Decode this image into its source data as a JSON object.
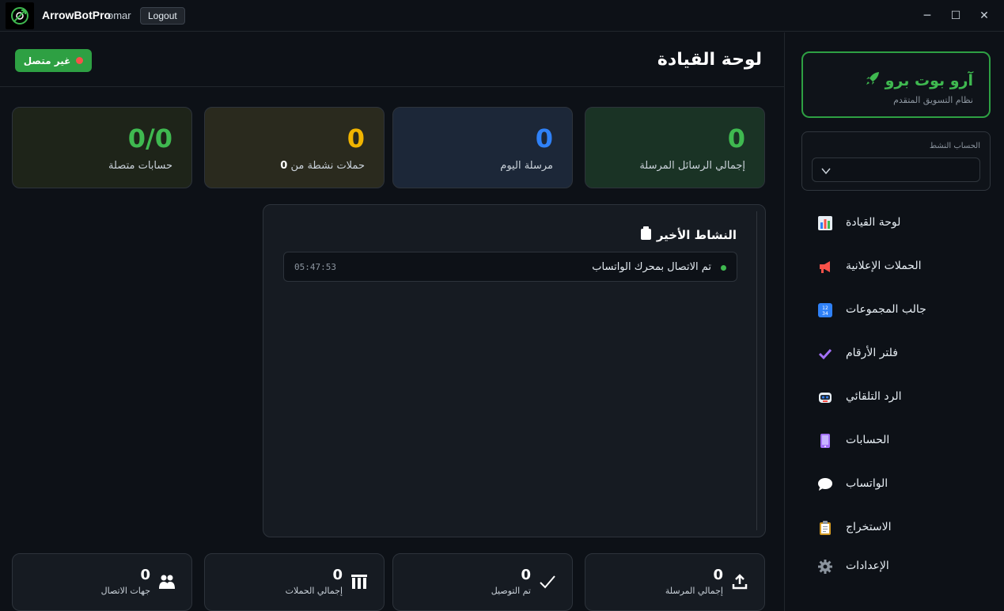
{
  "titlebar": {
    "app_name": "ArrowBotPro",
    "user": "omar",
    "logout_label": "Logout",
    "minimize": "─",
    "maximize": "☐",
    "close": "✕"
  },
  "header": {
    "title": "لوحة القيادة",
    "status_label": "غير متصل",
    "status_color": "#f85149"
  },
  "stats": [
    {
      "value": "0",
      "label": "إجمالي الرسائل المرسلة",
      "color": "#3fb950"
    },
    {
      "value": "0",
      "label": "مرسلة اليوم",
      "color": "#2f81f7"
    },
    {
      "value": "0",
      "label_prefix": "حملات نشطة من",
      "label_num": "0",
      "color": "#f0b400"
    },
    {
      "value": "0/0",
      "label": "حسابات متصلة",
      "color": "#3fb950"
    }
  ],
  "activity": {
    "title": "النشاط الأخير",
    "icon": "clipboard-icon",
    "items": [
      {
        "text": "تم الاتصال بمحرك الواتساب",
        "time": "05:47:53"
      }
    ]
  },
  "bottom_stats": [
    {
      "value": "0",
      "label": "إجمالي المرسلة",
      "icon": "upload-icon"
    },
    {
      "value": "0",
      "label": "تم التوصيل",
      "icon": "check-icon"
    },
    {
      "value": "0",
      "label": "إجمالي الحملات",
      "icon": "bars-icon"
    },
    {
      "value": "0",
      "label": "جهات الاتصال",
      "icon": "users-icon"
    }
  ],
  "sidebar": {
    "brand_title": "آرو بوت برو",
    "brand_subtitle": "نظام التسويق المتقدم",
    "account_label": "الحساب النشط",
    "nav": [
      {
        "label": "لوحة القيادة",
        "icon": "chart-icon"
      },
      {
        "label": "الحملات الإعلانية",
        "icon": "megaphone-icon"
      },
      {
        "label": "جالب المجموعات",
        "icon": "numbers-icon"
      },
      {
        "label": "فلتر الأرقام",
        "icon": "check-mark-icon"
      },
      {
        "label": "الرد التلقائي",
        "icon": "robot-icon"
      },
      {
        "label": "الحسابات",
        "icon": "phone-icon"
      },
      {
        "label": "الواتساب",
        "icon": "speech-bubble-icon"
      },
      {
        "label": "الاستخراج",
        "icon": "clipboard-icon"
      },
      {
        "label": "الإعدادات",
        "icon": "gear-icon"
      }
    ]
  },
  "colors": {
    "accent": "#2ea043",
    "bg": "#0d1117"
  }
}
